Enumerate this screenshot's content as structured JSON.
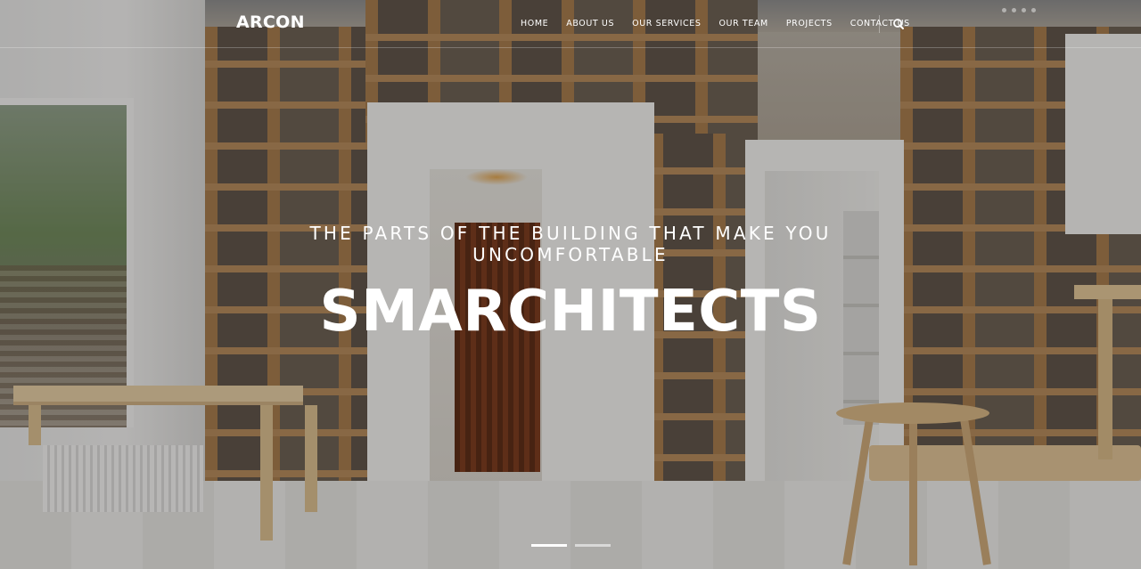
{
  "brand": {
    "logo_text": "ARCON"
  },
  "nav": {
    "items": [
      {
        "label": "HOME"
      },
      {
        "label": "ABOUT US"
      },
      {
        "label": "OUR SERVICES"
      },
      {
        "label": "OUR TEAM"
      },
      {
        "label": "PROJECTS"
      },
      {
        "label": "CONTACT US"
      }
    ],
    "search_icon": "search-icon"
  },
  "hero": {
    "subtitle": "THE PARTS OF THE BUILDING THAT MAKE YOU UNCOMFORTABLE",
    "title": "SMARCHITECTS",
    "slides_total": 2,
    "active_slide": 1
  },
  "colors": {
    "text": "#ffffff",
    "overlay": "#141210"
  }
}
